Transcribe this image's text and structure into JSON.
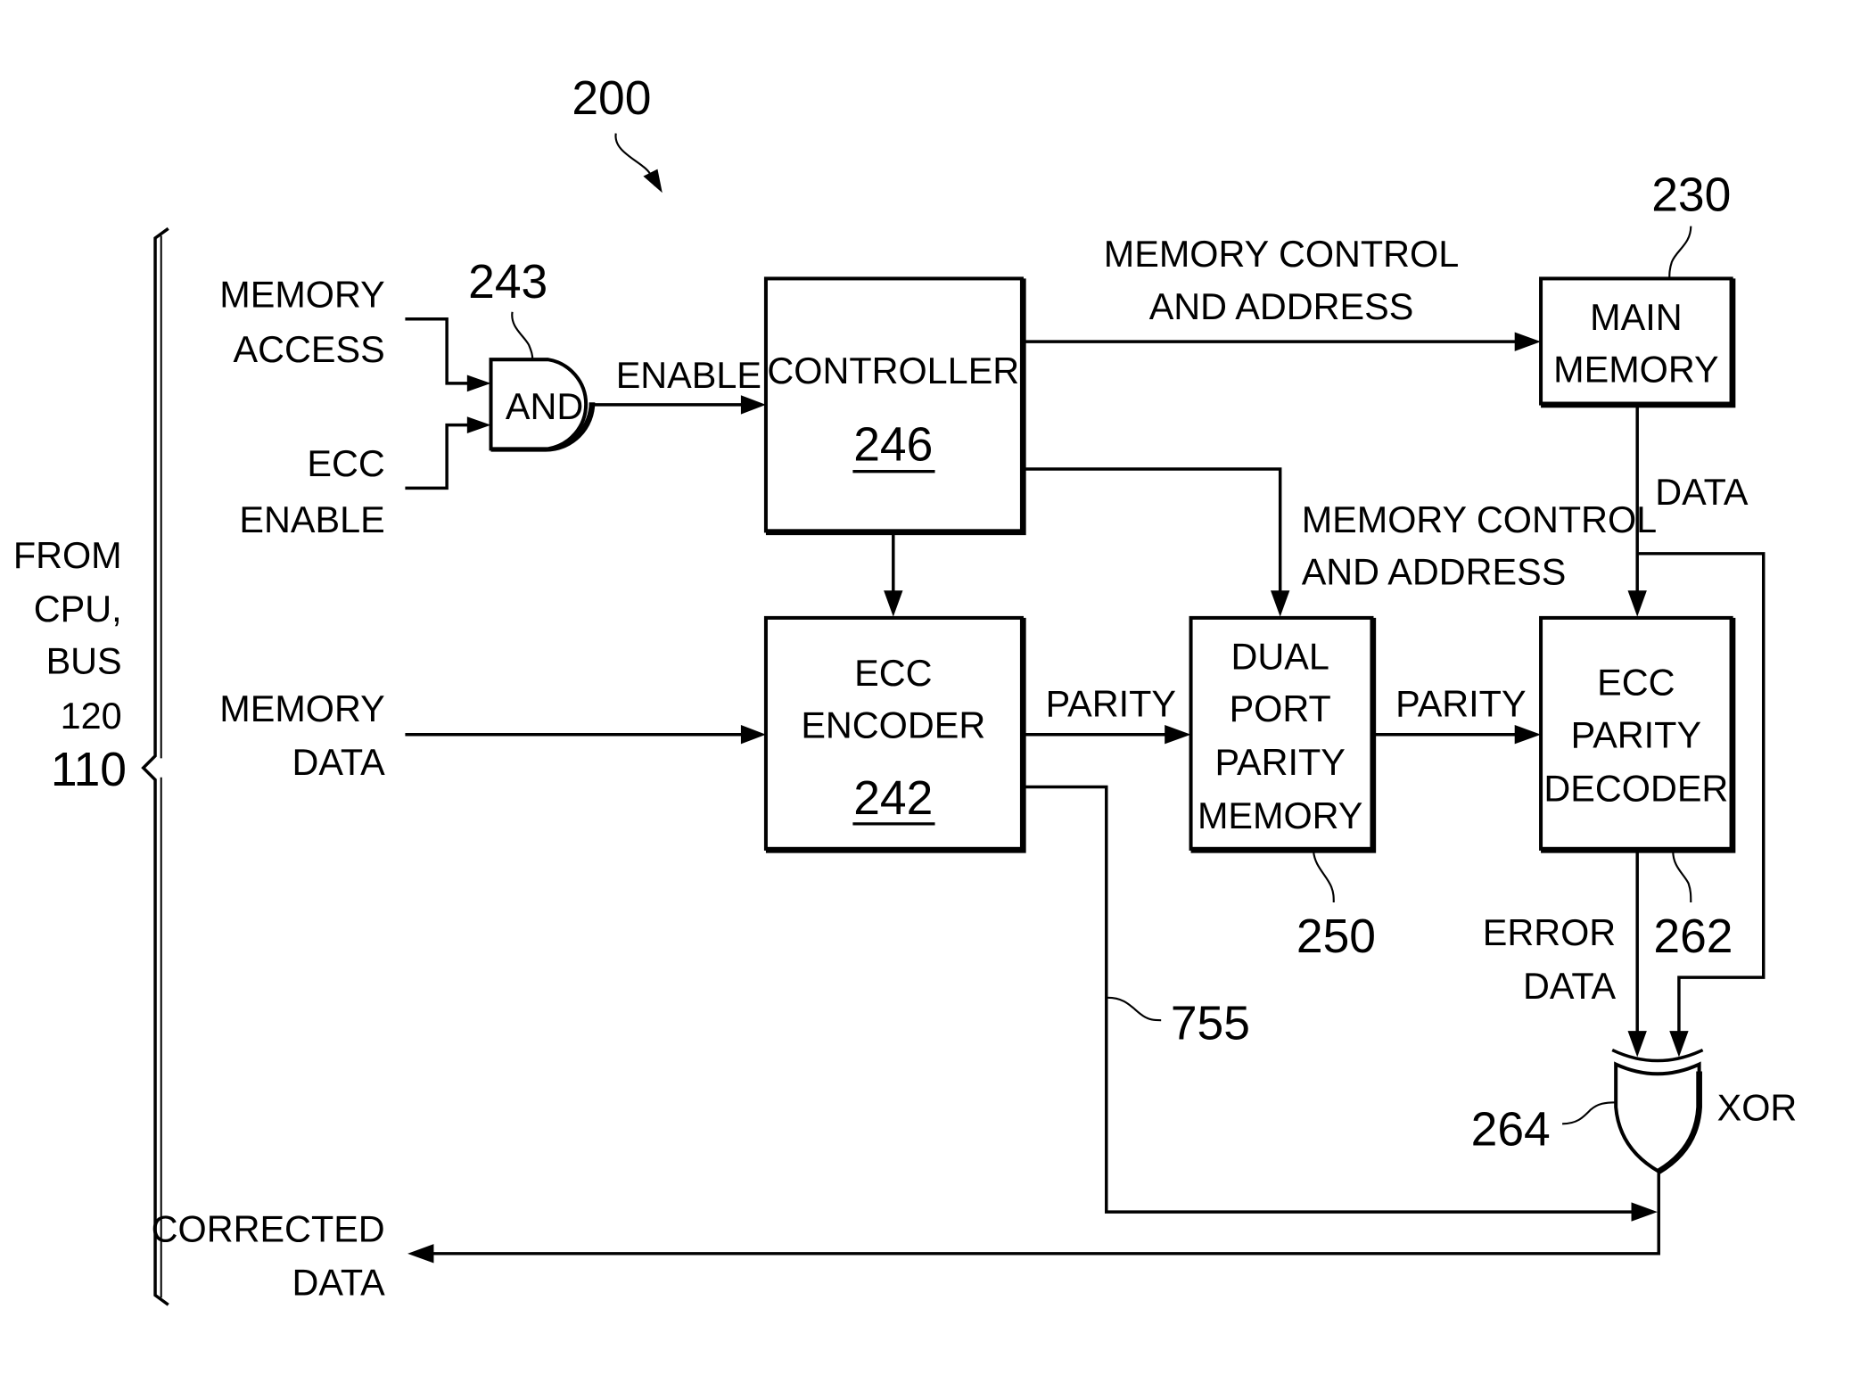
{
  "figure": {
    "reference_number": "200",
    "bus": {
      "label_lines": [
        "FROM",
        "CPU,",
        "BUS",
        "120"
      ],
      "reference_number": "110"
    },
    "inputs": {
      "memory_access": [
        "MEMORY",
        "ACCESS"
      ],
      "ecc_enable": [
        "ECC",
        "ENABLE"
      ],
      "memory_data": [
        "MEMORY",
        "DATA"
      ]
    },
    "output": {
      "corrected_data": [
        "CORRECTED",
        "DATA"
      ]
    },
    "blocks": {
      "and_gate": {
        "label": "AND",
        "ref": "243"
      },
      "controller": {
        "label": "CONTROLLER",
        "ref": "246"
      },
      "main_memory": {
        "label_lines": [
          "MAIN",
          "MEMORY"
        ],
        "ref": "230"
      },
      "ecc_encoder": {
        "label_lines": [
          "ECC",
          "ENCODER"
        ],
        "ref": "242"
      },
      "parity_memory": {
        "label_lines": [
          "DUAL",
          "PORT",
          "PARITY",
          "MEMORY"
        ],
        "ref": "250"
      },
      "parity_decoder": {
        "label_lines": [
          "ECC",
          "PARITY",
          "DECODER"
        ],
        "ref": "262"
      },
      "xor_gate": {
        "label": "XOR",
        "ref": "264"
      }
    },
    "signals": {
      "enable": "ENABLE",
      "mem_ctrl_top": [
        "MEMORY CONTROL",
        "AND ADDRESS"
      ],
      "mem_ctrl_mid": [
        "MEMORY CONTROL",
        "AND ADDRESS"
      ],
      "data": "DATA",
      "parity_1": "PARITY",
      "parity_2": "PARITY",
      "error_data": [
        "ERROR",
        "DATA"
      ],
      "bypass_ref": "755"
    }
  }
}
